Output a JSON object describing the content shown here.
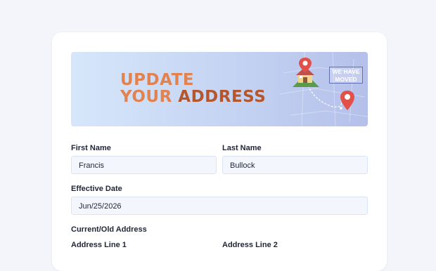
{
  "banner": {
    "title_line1": "UPDATE",
    "title_line2_a": "YOUR ",
    "title_line2_b": "ADDRESS",
    "sign_line1": "WE HAVE",
    "sign_line2": "MOVED",
    "colors": {
      "title": "#e2834f",
      "title_accent": "#b5562c",
      "pin": "#e2504a"
    }
  },
  "form": {
    "first_name": {
      "label": "First Name",
      "value": "Francis"
    },
    "last_name": {
      "label": "Last Name",
      "value": "Bullock"
    },
    "effective_date": {
      "label": "Effective Date",
      "value": "Jun/25/2026"
    },
    "old_address_heading": "Current/Old Address",
    "address_line1_label": "Address Line 1",
    "address_line2_label": "Address Line 2"
  }
}
